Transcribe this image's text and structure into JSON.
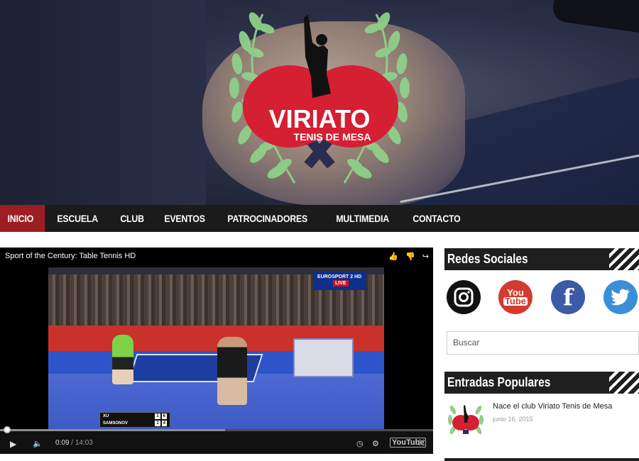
{
  "brand": {
    "name": "VIRIATO",
    "tagline": "TENIS DE MESA"
  },
  "nav": {
    "items": [
      {
        "label": "INICIO",
        "active": true
      },
      {
        "label": "ESCUELA"
      },
      {
        "label": "CLUB"
      },
      {
        "label": "EVENTOS"
      },
      {
        "label": "PATROCINADORES"
      },
      {
        "label": "MULTIMEDIA"
      },
      {
        "label": "CONTACTO"
      }
    ]
  },
  "video": {
    "title": "Sport of the Century: Table Tennis HD",
    "channel_logo": "EUROSPORT 2 HD",
    "live_label": "LIVE",
    "scoreboard": [
      {
        "name": "XU",
        "sets": "1",
        "points": "6"
      },
      {
        "name": "SAMSONOV",
        "sets": "1",
        "points": "4"
      }
    ],
    "current_time": "0:09",
    "separator": "/",
    "duration": "14:03",
    "played_fraction": 0.01,
    "buffered_fraction": 0.52,
    "youtube_label": "YouTube",
    "icons": [
      "like-icon",
      "dislike-icon",
      "share-icon",
      "play-icon",
      "volume-icon",
      "clock-icon",
      "settings-icon",
      "fullscreen-icon"
    ]
  },
  "sidebar": {
    "social_title": "Redes Sociales",
    "social": [
      {
        "name": "instagram-icon",
        "color": "#111111"
      },
      {
        "name": "youtube-icon",
        "color": "#d43a2f",
        "text1": "You",
        "text2": "Tube"
      },
      {
        "name": "facebook-icon",
        "color": "#3b5ba7",
        "text": "f"
      },
      {
        "name": "twitter-icon",
        "color": "#3b8ed8"
      }
    ],
    "search_placeholder": "Buscar",
    "popular_title": "Entradas Populares",
    "posts": [
      {
        "title": "Nace el club Viriato Tenis de Mesa",
        "date": "junio 16, 2015"
      }
    ]
  },
  "colors": {
    "nav_bg": "#1b1b1b",
    "active": "#9c1e22",
    "logo_red": "#d51f33",
    "laurel": "#8fd08a"
  }
}
